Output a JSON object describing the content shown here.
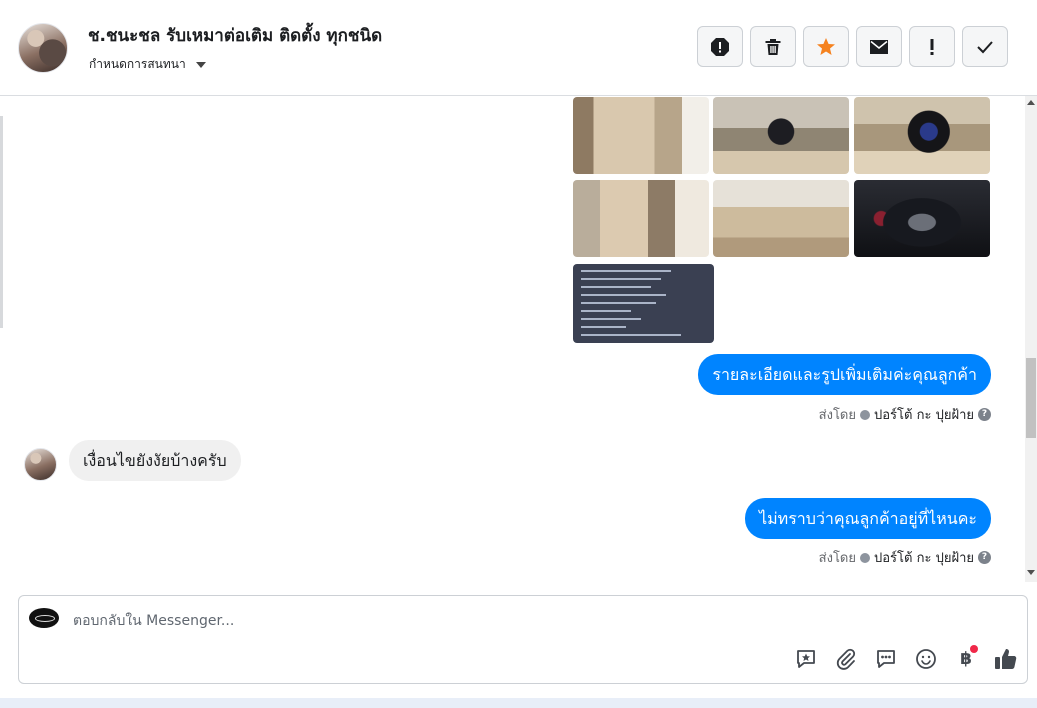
{
  "header": {
    "title": "ช.ชนะชล รับเหมาต่อเติม ติดตั้ง ทุกชนิด",
    "assign_label": "กำหนดการสนทนา",
    "tools": [
      {
        "name": "report-icon"
      },
      {
        "name": "trash-icon"
      },
      {
        "name": "star-icon",
        "color": "#f5821f"
      },
      {
        "name": "envelope-icon"
      },
      {
        "name": "exclamation-icon"
      },
      {
        "name": "checkmark-icon"
      }
    ]
  },
  "thread": {
    "photos": [
      {
        "name": "car-door-photo"
      },
      {
        "name": "car-interior-photo"
      },
      {
        "name": "steering-wheel-photo"
      },
      {
        "name": "car-seat-photo"
      },
      {
        "name": "rear-seat-photo"
      },
      {
        "name": "dashboard-gauge-photo"
      },
      {
        "name": "car-spec-document-photo"
      }
    ],
    "messages": [
      {
        "direction": "out",
        "text": "รายละเอียดและรูปเพิ่มเติมค่ะคุณลูกค้า",
        "sent_by_prefix": "ส่งโดย",
        "sent_by_name": "ปอร์โต้ กะ ปุยฝ้าย"
      },
      {
        "direction": "in",
        "text": "เงื่อนไขยังงัยบ้างครับ"
      },
      {
        "direction": "out",
        "text": "ไม่ทราบว่าคุณลูกค้าอยู่ที่ไหนคะ",
        "sent_by_prefix": "ส่งโดย",
        "sent_by_name": "ปอร์โต้ กะ ปุยฝ้าย"
      }
    ]
  },
  "composer": {
    "placeholder": "ตอบกลับใน Messenger...",
    "icons": [
      "saved-reply-icon",
      "attachment-icon",
      "quick-reply-icon",
      "emoji-icon",
      "baht-payment-icon",
      "thumbs-up-icon"
    ],
    "baht_symbol": "฿"
  },
  "colors": {
    "brand_blue": "#0084ff",
    "bubble_in": "#f0f0f0"
  }
}
